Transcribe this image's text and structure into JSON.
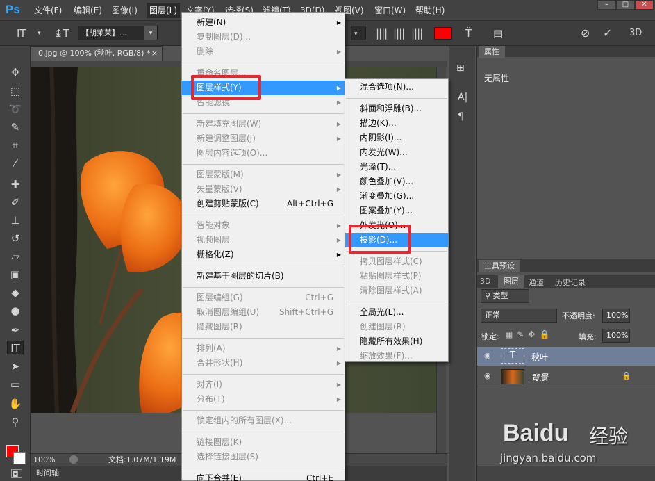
{
  "menubar": {
    "logo": "Ps",
    "items": [
      "文件(F)",
      "编辑(E)",
      "图像(I)",
      "图层(L)",
      "文字(Y)",
      "选择(S)",
      "滤镜(T)",
      "3D(D)",
      "视图(V)",
      "窗口(W)",
      "帮助(H)"
    ],
    "active_index": 3,
    "window_buttons": [
      "–",
      "□",
      "✕"
    ]
  },
  "options_bar": {
    "font_family": "【胡苿苿】...",
    "color_swatch": "#ff0000",
    "three_d_label": "3D"
  },
  "document": {
    "tab_title": "0.jpg @ 100% (秋叶, RGB/8) *",
    "tab_close": "×",
    "zoom": "100%",
    "doc_size": "文档:1.07M/1.19M"
  },
  "timeline": {
    "label": "时间轴"
  },
  "properties": {
    "tab": "属性",
    "content": "无属性"
  },
  "tool_presets": {
    "tab": "工具预设"
  },
  "layers_panel": {
    "tabs": [
      "3D",
      "图层",
      "通道",
      "历史记录"
    ],
    "filter_kind": "类型",
    "blend_mode": "正常",
    "opacity_label": "不透明度:",
    "opacity_value": "100%",
    "lock_label": "锁定:",
    "fill_label": "填充:",
    "fill_value": "100%",
    "layers": [
      {
        "name": "秋叶",
        "type": "text",
        "selected": true
      },
      {
        "name": "背景",
        "type": "image",
        "selected": false
      }
    ]
  },
  "layer_menu": {
    "items": [
      {
        "label": "新建(N)",
        "arrow": true
      },
      {
        "label": "复制图层(D)...",
        "disabled": true
      },
      {
        "label": "删除",
        "disabled": true,
        "arrow": true
      },
      {
        "sep": true
      },
      {
        "label": "重命名图层...",
        "disabled": true
      },
      {
        "label": "图层样式(Y)",
        "arrow": true,
        "highlight": true
      },
      {
        "label": "智能滤镜",
        "disabled": true,
        "arrow": true
      },
      {
        "sep": true
      },
      {
        "label": "新建填充图层(W)",
        "disabled": true,
        "arrow": true
      },
      {
        "label": "新建调整图层(J)",
        "disabled": true,
        "arrow": true
      },
      {
        "label": "图层内容选项(O)...",
        "disabled": true
      },
      {
        "sep": true
      },
      {
        "label": "图层蒙版(M)",
        "disabled": true,
        "arrow": true
      },
      {
        "label": "矢量蒙版(V)",
        "disabled": true,
        "arrow": true
      },
      {
        "label": "创建剪贴蒙版(C)",
        "shortcut": "Alt+Ctrl+G"
      },
      {
        "sep": true
      },
      {
        "label": "智能对象",
        "disabled": true,
        "arrow": true
      },
      {
        "label": "视频图层",
        "disabled": true,
        "arrow": true
      },
      {
        "label": "栅格化(Z)",
        "arrow": true
      },
      {
        "sep": true
      },
      {
        "label": "新建基于图层的切片(B)"
      },
      {
        "sep": true
      },
      {
        "label": "图层编组(G)",
        "shortcut": "Ctrl+G",
        "disabled": true
      },
      {
        "label": "取消图层编组(U)",
        "shortcut": "Shift+Ctrl+G",
        "disabled": true
      },
      {
        "label": "隐藏图层(R)",
        "disabled": true
      },
      {
        "sep": true
      },
      {
        "label": "排列(A)",
        "disabled": true,
        "arrow": true
      },
      {
        "label": "合并形状(H)",
        "disabled": true,
        "arrow": true
      },
      {
        "sep": true
      },
      {
        "label": "对齐(I)",
        "disabled": true,
        "arrow": true
      },
      {
        "label": "分布(T)",
        "disabled": true,
        "arrow": true
      },
      {
        "sep": true
      },
      {
        "label": "锁定组内的所有图层(X)...",
        "disabled": true
      },
      {
        "sep": true
      },
      {
        "label": "链接图层(K)",
        "disabled": true
      },
      {
        "label": "选择链接图层(S)",
        "disabled": true
      },
      {
        "sep": true
      },
      {
        "label": "向下合并(E)",
        "shortcut": "Ctrl+E"
      }
    ]
  },
  "style_submenu": {
    "items": [
      {
        "label": "混合选项(N)..."
      },
      {
        "sep": true
      },
      {
        "label": "斜面和浮雕(B)..."
      },
      {
        "label": "描边(K)..."
      },
      {
        "label": "内阴影(I)..."
      },
      {
        "label": "内发光(W)..."
      },
      {
        "label": "光泽(T)..."
      },
      {
        "label": "颜色叠加(V)..."
      },
      {
        "label": "渐变叠加(G)..."
      },
      {
        "label": "图案叠加(Y)..."
      },
      {
        "label": "外发光(O)..."
      },
      {
        "label": "投影(D)...",
        "highlight": true
      },
      {
        "sep": true
      },
      {
        "label": "拷贝图层样式(C)",
        "disabled": true
      },
      {
        "label": "粘贴图层样式(P)",
        "disabled": true
      },
      {
        "label": "清除图层样式(A)",
        "disabled": true
      },
      {
        "sep": true
      },
      {
        "label": "全局光(L)..."
      },
      {
        "label": "创建图层(R)",
        "disabled": true
      },
      {
        "label": "隐藏所有效果(H)"
      },
      {
        "label": "缩放效果(F)...",
        "disabled": true
      }
    ]
  },
  "watermark": {
    "brand": "Baidu",
    "brand_cn": "经验",
    "url": "jingyan.baidu.com"
  },
  "colors": {
    "highlight": "#3399ff",
    "annotation_red": "#e8282e",
    "leaf_orange": "#e8701a"
  }
}
